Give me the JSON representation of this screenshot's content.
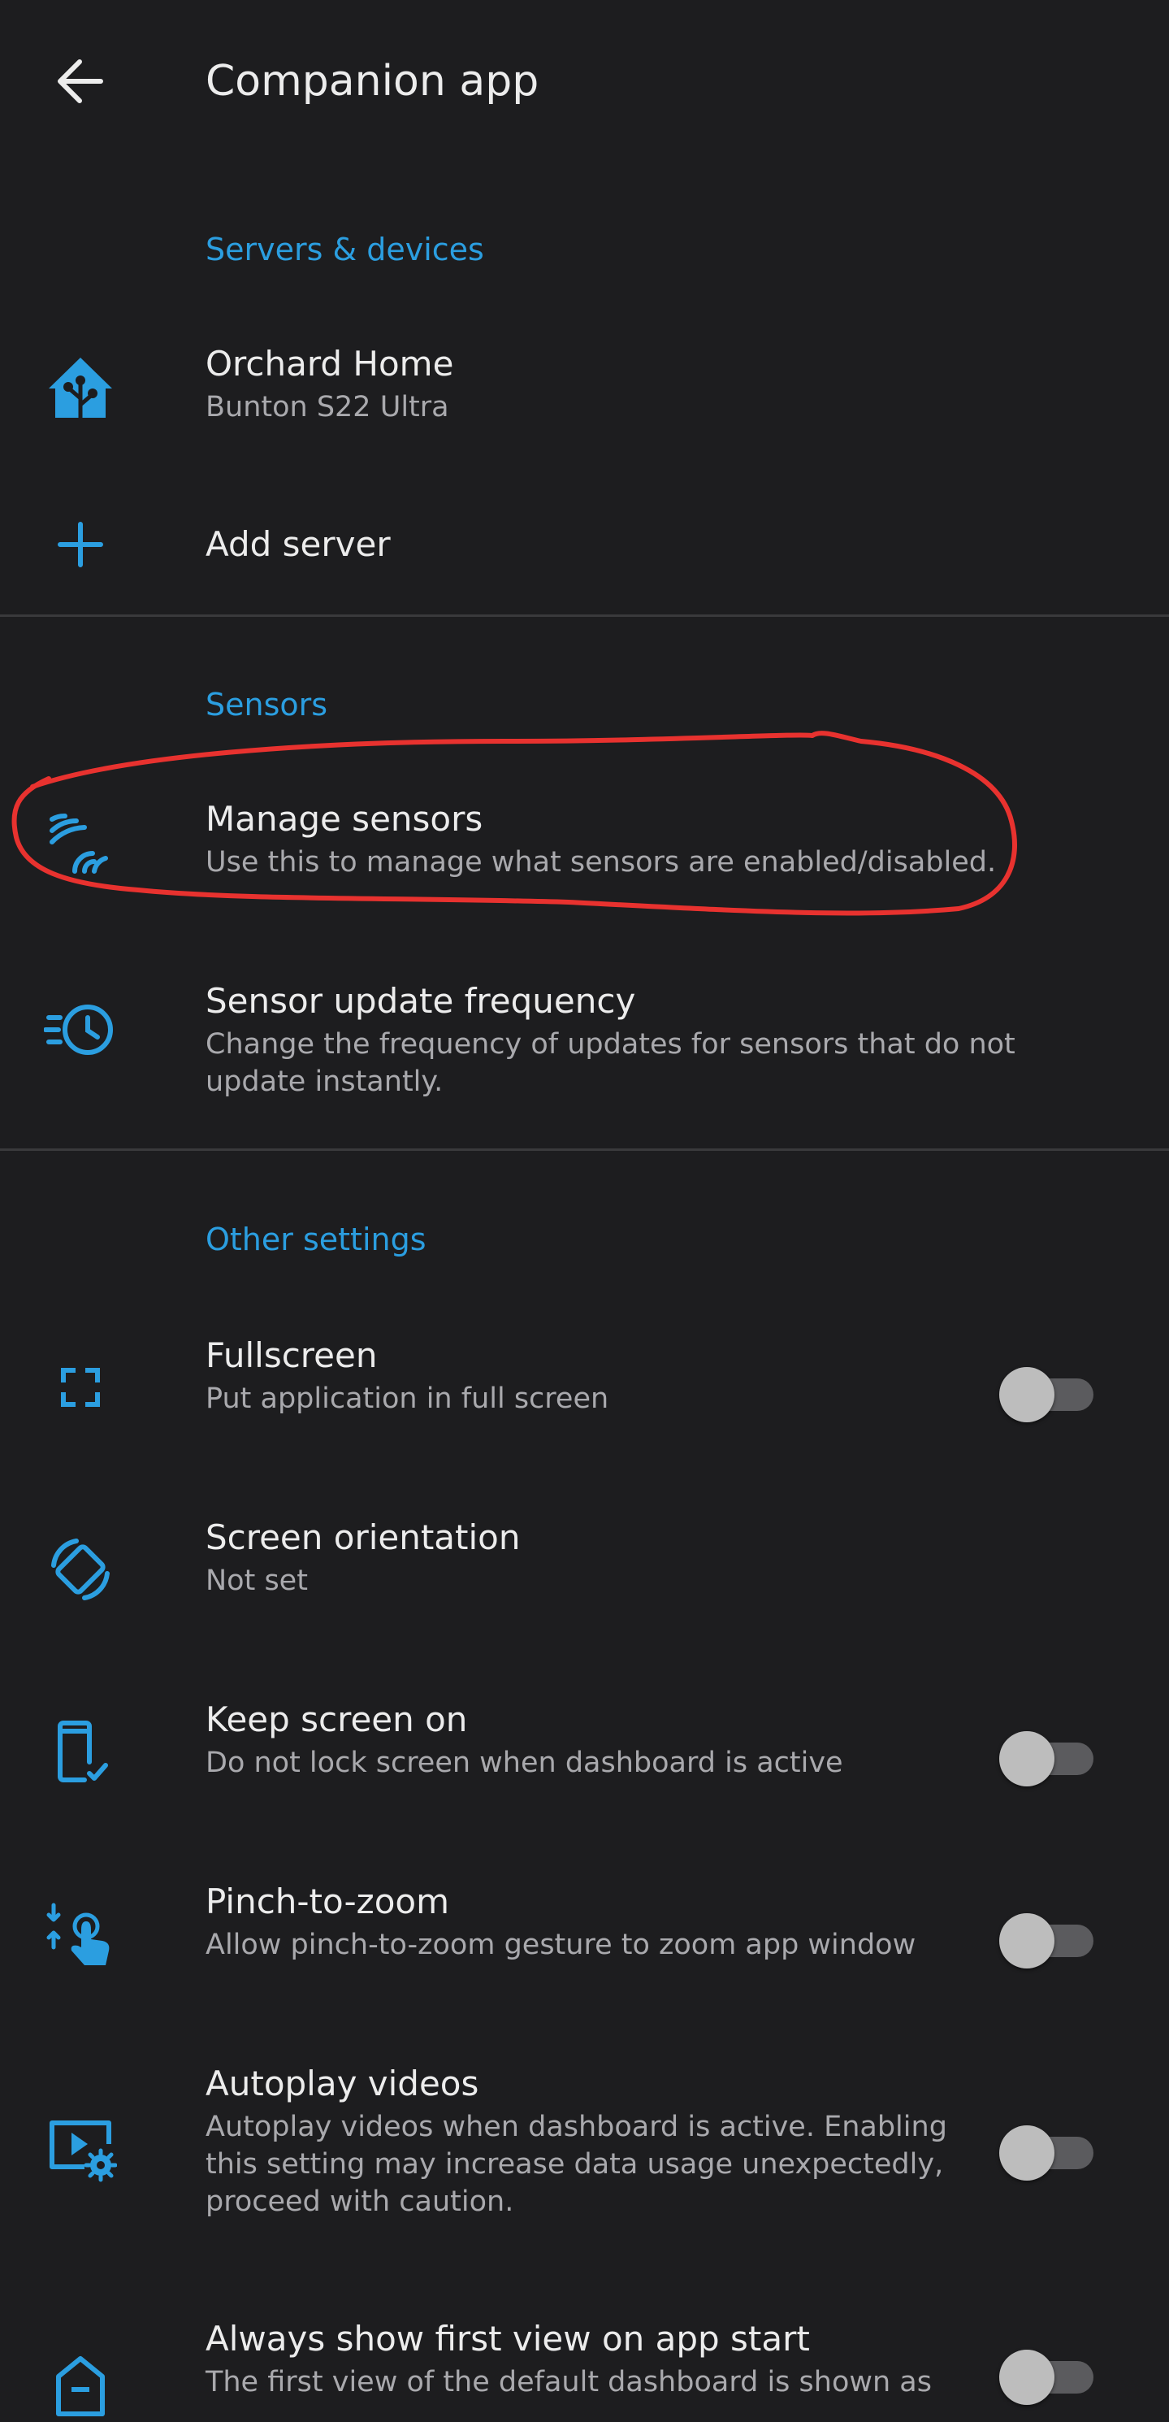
{
  "appbar": {
    "title": "Companion app",
    "back_icon": "arrow-back-icon"
  },
  "colors": {
    "background": "#1d1d1f",
    "accent": "#2b9ee0",
    "primary_text": "#ececec",
    "secondary_text": "#a9a9ad",
    "annotation_circle": "#e8322f"
  },
  "sections": {
    "servers": {
      "header": "Servers & devices",
      "items": [
        {
          "icon": "home-assistant-icon",
          "title": "Orchard Home",
          "subtitle": "Bunton S22 Ultra"
        },
        {
          "icon": "plus-icon",
          "title": "Add server"
        }
      ]
    },
    "sensors": {
      "header": "Sensors",
      "items": [
        {
          "icon": "sensors-icon",
          "title": "Manage sensors",
          "subtitle": "Use this to manage what sensors are enabled/disabled."
        },
        {
          "icon": "update-frequency-icon",
          "title": "Sensor update frequency",
          "subtitle": "Change the frequency of updates for sensors that do not update instantly."
        }
      ]
    },
    "other": {
      "header": "Other settings",
      "items": [
        {
          "icon": "fullscreen-icon",
          "title": "Fullscreen",
          "subtitle": "Put application in full screen",
          "toggle": false
        },
        {
          "icon": "screen-rotation-icon",
          "title": "Screen orientation",
          "subtitle": "Not set"
        },
        {
          "icon": "phone-check-icon",
          "title": "Keep screen on",
          "subtitle": "Do not lock screen when dashboard is active",
          "toggle": false
        },
        {
          "icon": "gesture-tap-icon",
          "title": "Pinch-to-zoom",
          "subtitle": "Allow pinch-to-zoom gesture to zoom app window",
          "toggle": false
        },
        {
          "icon": "video-settings-icon",
          "title": "Autoplay videos",
          "subtitle": "Autoplay videos when dashboard is active. Enabling this setting may increase data usage unexpectedly, proceed with caution.",
          "toggle": false
        },
        {
          "icon": "home-icon",
          "title": "Always show first view on app start",
          "subtitle": "The first view of the default dashboard is shown as",
          "toggle": false
        }
      ]
    }
  }
}
